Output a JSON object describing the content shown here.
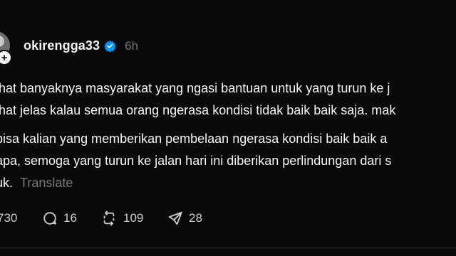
{
  "post": {
    "username": "okirengga33",
    "time": "6h",
    "lines": [
      "ihat banyaknya masyarakat yang ngasi bantuan untuk yang turun ke j",
      "ihat jelas kalau semua orang ngerasa kondisi tidak baik baik saja. mak",
      " bisa kalian yang memberikan pembelaan ngerasa kondisi baik baik a",
      "apa, semoga yang turun ke jalan hari ini diberikan perlindungan dari s",
      "uk."
    ],
    "translate_label": "Translate"
  },
  "actions": {
    "likes": "730",
    "replies": "16",
    "reposts": "109",
    "shares": "28"
  },
  "colors": {
    "background": "#0a0a0a",
    "text": "#f3f5f7",
    "muted": "#777777",
    "verified": "#0095f6"
  }
}
